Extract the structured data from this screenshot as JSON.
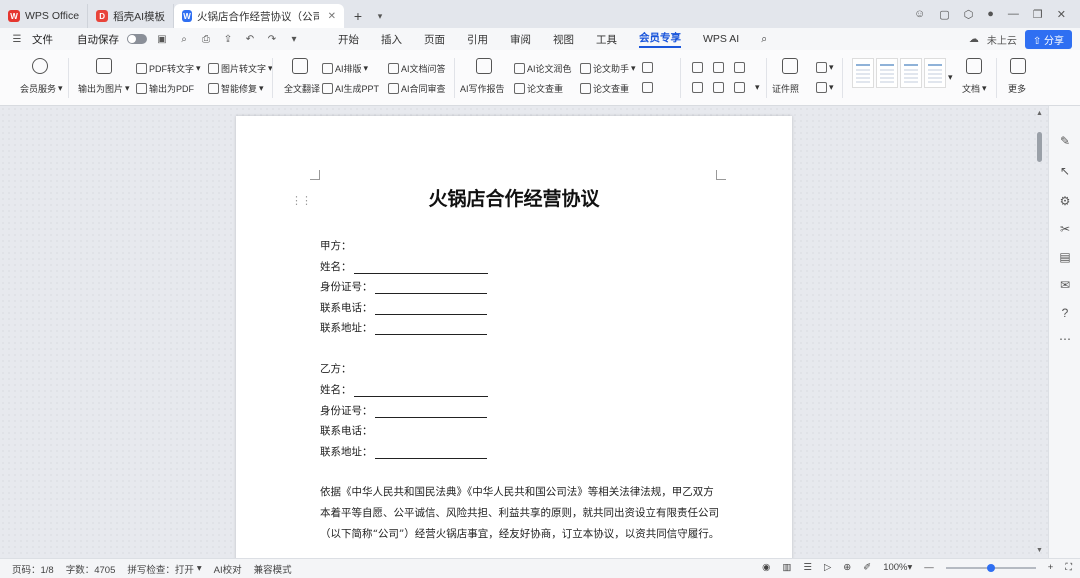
{
  "tabs": [
    {
      "label": "WPS Office",
      "color": "#e5362f",
      "letter": "W",
      "active": false
    },
    {
      "label": "稻壳AI模板",
      "color": "#e8443a",
      "letter": "D",
      "active": false
    },
    {
      "label": "火锅店合作经营协议（公司）.d",
      "color": "#2f6ff2",
      "letter": "W",
      "active": true
    }
  ],
  "menubar": {
    "file": "文件",
    "autosave": "自动保存",
    "menus": [
      "开始",
      "插入",
      "页面",
      "引用",
      "审阅",
      "视图",
      "工具",
      "会员专享",
      "WPS AI"
    ],
    "active_menu": "会员专享",
    "share": "分享",
    "unlogged": "未上云"
  },
  "ribbon": {
    "items": [
      "会员服务",
      "输出为图片",
      "输出为PDF",
      "PDF转文字",
      "图片转文字",
      "智能修复",
      "全文翻译",
      "AI排版",
      "AI生成PPT",
      "AI文档问答",
      "AI合同审查",
      "AI写作报告",
      "AI论文润色",
      "论文查重",
      "论文助手",
      "论文查重",
      "智能表格",
      "证件照",
      "文档",
      "更多"
    ]
  },
  "document": {
    "title": "火锅店合作经营协议",
    "party_a": "甲方：",
    "party_a_fields": [
      "姓名：",
      "身份证号：",
      "联系电话：",
      "联系地址："
    ],
    "party_b": "乙方：",
    "party_b_fields": [
      "姓名：",
      "身份证号：",
      "联系电话：",
      "联系地址："
    ],
    "paragraph": "依据《中华人民共和国民法典》《中华人民共和国公司法》等相关法律法规，甲乙双方本着平等自愿、公平诚信、风险共担、利益共享的原则，就共同出资设立有限责任公司（以下简称“公司”）经营火锅店事宜，经友好协商，订立本协议，以资共同信守履行。"
  },
  "statusbar": {
    "page": "页码：1/8",
    "words": "字数：4705",
    "spell": "拼写检查：打开",
    "ai": "AI校对",
    "mode": "兼容模式",
    "zoom": "100%",
    "zoom_level": 0.5
  }
}
